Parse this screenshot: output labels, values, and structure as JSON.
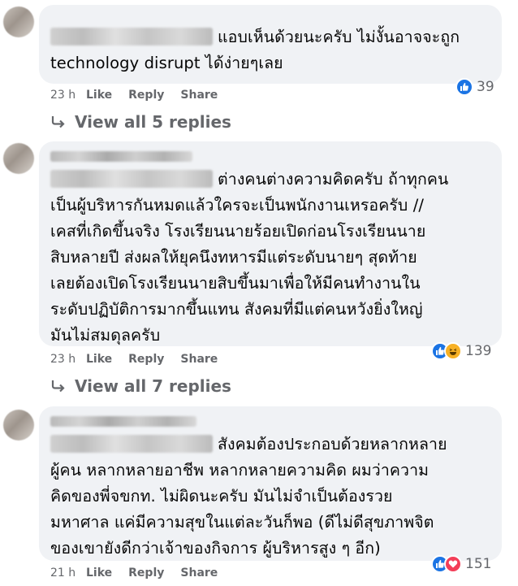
{
  "comments": [
    {
      "text": "แอบเห็นด้วยนะครับ ไม่งั้นอาจจะถูก\ntechnology disrupt ได้ง่ายๆเลย",
      "time": "23 h",
      "like_label": "Like",
      "reply_label": "Reply",
      "share_label": "Share",
      "reaction_count": "39",
      "reactions": [
        "like"
      ],
      "view_replies": "View all 5 replies"
    },
    {
      "text": "ต่างคนต่างความคิดครับ ถ้าทุกคน\nเป็นผู้บริหารกันหมดแล้วใครจะเป็นพนักงานเหรอครับ //\nเคสที่เกิดขึ้นจริง โรงเรียนนายร้อยเปิดก่อนโรงเรียนนาย\nสิบหลายปี ส่งผลให้ยุคนึงทหารมีแต่ระดับนายๆ สุดท้าย\nเลยต้องเปิดโรงเรียนนายสิบขึ้นมาเพื่อให้มีคนทำงานใน\nระดับปฏิบัติการมากขึ้นแทน สังคมที่มีแต่คนหวังยิ่งใหญ่\nมันไม่สมดุลครับ",
      "time": "23 h",
      "like_label": "Like",
      "reply_label": "Reply",
      "share_label": "Share",
      "reaction_count": "139",
      "reactions": [
        "like",
        "haha"
      ],
      "view_replies": "View all 7 replies"
    },
    {
      "text": "สังคมต้องประกอบด้วยหลากหลาย\nผู้คน หลากหลายอาชีพ หลากหลายความคิด ผมว่าความ\nคิดของพี่จขกท. ไม่ผิดนะครับ มันไม่จำเป็นต้องรวย\nมหาศาล แค่มีความสุขในแต่ละวันก็พอ (ดีไม่ดีสุขภาพจิต\nของเขายังดีกว่าเจ้าของกิจการ ผู้บริหารสูง ๆ อีก)",
      "time": "21 h",
      "like_label": "Like",
      "reply_label": "Reply",
      "share_label": "Share",
      "reaction_count": "151",
      "reactions": [
        "like",
        "love"
      ]
    }
  ],
  "colors": {
    "bubble_bg": "#f0f2f5",
    "meta_text": "#65676b",
    "like_blue": "#1b74e4",
    "haha_yellow": "#f7b125",
    "love_red": "#f33e58"
  }
}
